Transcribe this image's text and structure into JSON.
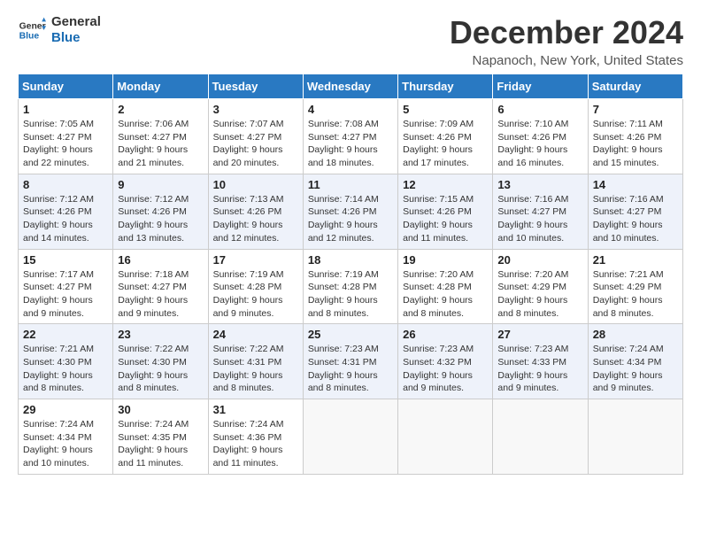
{
  "logo": {
    "line1": "General",
    "line2": "Blue"
  },
  "title": "December 2024",
  "subtitle": "Napanoch, New York, United States",
  "days_of_week": [
    "Sunday",
    "Monday",
    "Tuesday",
    "Wednesday",
    "Thursday",
    "Friday",
    "Saturday"
  ],
  "weeks": [
    [
      {
        "day": "1",
        "sunrise": "7:05 AM",
        "sunset": "4:27 PM",
        "daylight": "9 hours and 22 minutes."
      },
      {
        "day": "2",
        "sunrise": "7:06 AM",
        "sunset": "4:27 PM",
        "daylight": "9 hours and 21 minutes."
      },
      {
        "day": "3",
        "sunrise": "7:07 AM",
        "sunset": "4:27 PM",
        "daylight": "9 hours and 20 minutes."
      },
      {
        "day": "4",
        "sunrise": "7:08 AM",
        "sunset": "4:27 PM",
        "daylight": "9 hours and 18 minutes."
      },
      {
        "day": "5",
        "sunrise": "7:09 AM",
        "sunset": "4:26 PM",
        "daylight": "9 hours and 17 minutes."
      },
      {
        "day": "6",
        "sunrise": "7:10 AM",
        "sunset": "4:26 PM",
        "daylight": "9 hours and 16 minutes."
      },
      {
        "day": "7",
        "sunrise": "7:11 AM",
        "sunset": "4:26 PM",
        "daylight": "9 hours and 15 minutes."
      }
    ],
    [
      {
        "day": "8",
        "sunrise": "7:12 AM",
        "sunset": "4:26 PM",
        "daylight": "9 hours and 14 minutes."
      },
      {
        "day": "9",
        "sunrise": "7:12 AM",
        "sunset": "4:26 PM",
        "daylight": "9 hours and 13 minutes."
      },
      {
        "day": "10",
        "sunrise": "7:13 AM",
        "sunset": "4:26 PM",
        "daylight": "9 hours and 12 minutes."
      },
      {
        "day": "11",
        "sunrise": "7:14 AM",
        "sunset": "4:26 PM",
        "daylight": "9 hours and 12 minutes."
      },
      {
        "day": "12",
        "sunrise": "7:15 AM",
        "sunset": "4:26 PM",
        "daylight": "9 hours and 11 minutes."
      },
      {
        "day": "13",
        "sunrise": "7:16 AM",
        "sunset": "4:27 PM",
        "daylight": "9 hours and 10 minutes."
      },
      {
        "day": "14",
        "sunrise": "7:16 AM",
        "sunset": "4:27 PM",
        "daylight": "9 hours and 10 minutes."
      }
    ],
    [
      {
        "day": "15",
        "sunrise": "7:17 AM",
        "sunset": "4:27 PM",
        "daylight": "9 hours and 9 minutes."
      },
      {
        "day": "16",
        "sunrise": "7:18 AM",
        "sunset": "4:27 PM",
        "daylight": "9 hours and 9 minutes."
      },
      {
        "day": "17",
        "sunrise": "7:19 AM",
        "sunset": "4:28 PM",
        "daylight": "9 hours and 9 minutes."
      },
      {
        "day": "18",
        "sunrise": "7:19 AM",
        "sunset": "4:28 PM",
        "daylight": "9 hours and 8 minutes."
      },
      {
        "day": "19",
        "sunrise": "7:20 AM",
        "sunset": "4:28 PM",
        "daylight": "9 hours and 8 minutes."
      },
      {
        "day": "20",
        "sunrise": "7:20 AM",
        "sunset": "4:29 PM",
        "daylight": "9 hours and 8 minutes."
      },
      {
        "day": "21",
        "sunrise": "7:21 AM",
        "sunset": "4:29 PM",
        "daylight": "9 hours and 8 minutes."
      }
    ],
    [
      {
        "day": "22",
        "sunrise": "7:21 AM",
        "sunset": "4:30 PM",
        "daylight": "9 hours and 8 minutes."
      },
      {
        "day": "23",
        "sunrise": "7:22 AM",
        "sunset": "4:30 PM",
        "daylight": "9 hours and 8 minutes."
      },
      {
        "day": "24",
        "sunrise": "7:22 AM",
        "sunset": "4:31 PM",
        "daylight": "9 hours and 8 minutes."
      },
      {
        "day": "25",
        "sunrise": "7:23 AM",
        "sunset": "4:31 PM",
        "daylight": "9 hours and 8 minutes."
      },
      {
        "day": "26",
        "sunrise": "7:23 AM",
        "sunset": "4:32 PM",
        "daylight": "9 hours and 9 minutes."
      },
      {
        "day": "27",
        "sunrise": "7:23 AM",
        "sunset": "4:33 PM",
        "daylight": "9 hours and 9 minutes."
      },
      {
        "day": "28",
        "sunrise": "7:24 AM",
        "sunset": "4:34 PM",
        "daylight": "9 hours and 9 minutes."
      }
    ],
    [
      {
        "day": "29",
        "sunrise": "7:24 AM",
        "sunset": "4:34 PM",
        "daylight": "9 hours and 10 minutes."
      },
      {
        "day": "30",
        "sunrise": "7:24 AM",
        "sunset": "4:35 PM",
        "daylight": "9 hours and 11 minutes."
      },
      {
        "day": "31",
        "sunrise": "7:24 AM",
        "sunset": "4:36 PM",
        "daylight": "9 hours and 11 minutes."
      },
      null,
      null,
      null,
      null
    ]
  ],
  "labels": {
    "sunrise": "Sunrise:",
    "sunset": "Sunset:",
    "daylight": "Daylight:"
  }
}
